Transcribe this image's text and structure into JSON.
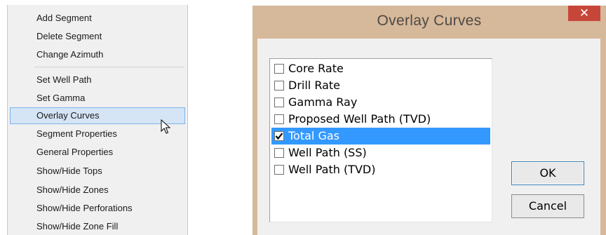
{
  "context_menu": {
    "items": [
      {
        "label": "Add Segment"
      },
      {
        "label": "Delete Segment"
      },
      {
        "label": "Change Azimuth"
      },
      {
        "label": "Set Well Path"
      },
      {
        "label": "Set Gamma"
      },
      {
        "label": "Overlay Curves",
        "highlighted": true
      },
      {
        "label": "Segment Properties"
      },
      {
        "label": "General Properties"
      },
      {
        "label": "Show/Hide Tops"
      },
      {
        "label": "Show/Hide Zones"
      },
      {
        "label": "Show/Hide Perforations"
      },
      {
        "label": "Show/Hide Zone Fill"
      }
    ]
  },
  "dialog": {
    "title": "Overlay Curves",
    "close_label": "✕",
    "list_items": [
      {
        "label": "Core Rate",
        "checked": false,
        "selected": false
      },
      {
        "label": "Drill Rate",
        "checked": false,
        "selected": false
      },
      {
        "label": "Gamma Ray",
        "checked": false,
        "selected": false
      },
      {
        "label": "Proposed Well Path (TVD)",
        "checked": false,
        "selected": false
      },
      {
        "label": "Total Gas",
        "checked": true,
        "selected": true
      },
      {
        "label": "Well Path (SS)",
        "checked": false,
        "selected": false
      },
      {
        "label": "Well Path (TVD)",
        "checked": false,
        "selected": false
      }
    ],
    "ok_label": "OK",
    "cancel_label": "Cancel"
  },
  "colors": {
    "title_bar": "#d6b89a",
    "close_button": "#c7463a",
    "selection": "#3399ff",
    "menu_hover": "#d5e5f6"
  },
  "icons": {
    "cursor": "arrow-cursor-icon",
    "check": "checkmark-icon"
  }
}
